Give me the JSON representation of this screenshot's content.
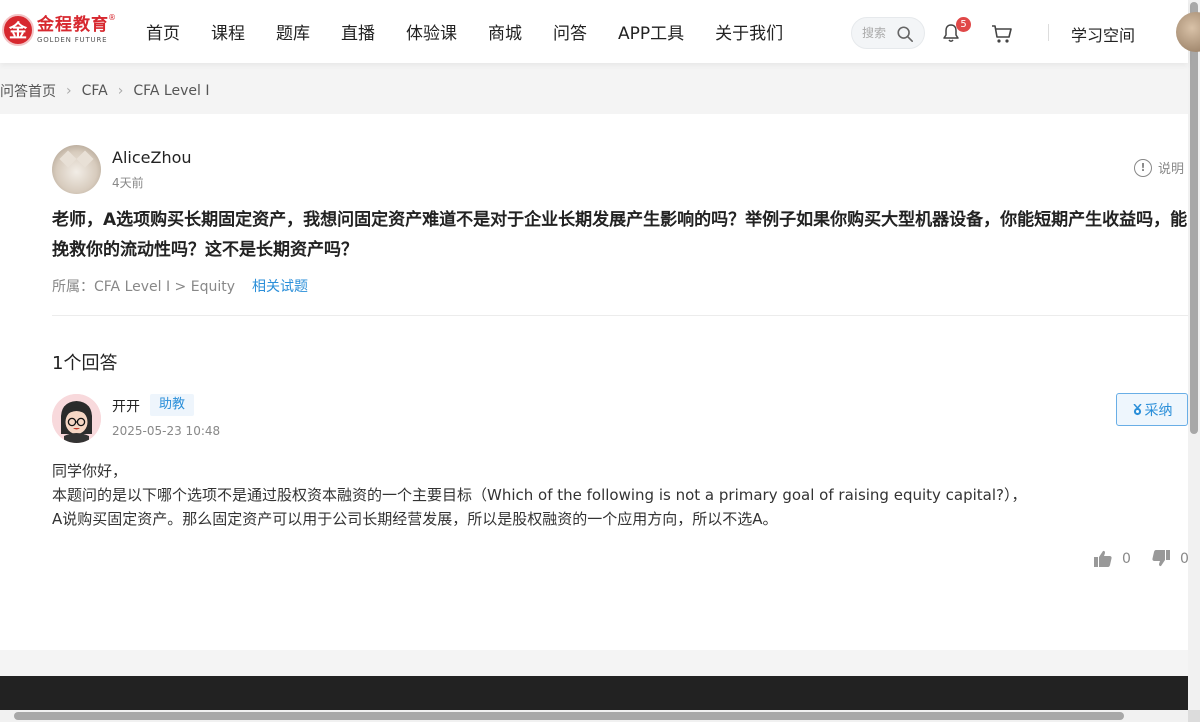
{
  "header": {
    "logo_mark": "金",
    "logo_cn": "金程教育",
    "logo_en": "GOLDEN FUTURE",
    "logo_reg": "®",
    "nav": [
      "首页",
      "课程",
      "题库",
      "直播",
      "体验课",
      "商城",
      "问答",
      "APP工具",
      "关于我们"
    ],
    "search_placeholder": "搜索",
    "notification_count": "5",
    "study_space": "学习空间"
  },
  "breadcrumb": [
    "问答首页",
    "CFA",
    "CFA Level I"
  ],
  "question": {
    "user": "AliceZhou",
    "time": "4天前",
    "explain_label": "说明",
    "text": "老师，A选项购买长期固定资产，我想问固定资产难道不是对于企业长期发展产生影响的吗？举例子如果你购买大型机器设备，你能短期产生收益吗，能挽救你的流动性吗？这不是长期资产吗？",
    "belong": "所属：CFA Level I > Equity",
    "related_label": "相关试题"
  },
  "answers": {
    "count_label": "1个回答",
    "items": [
      {
        "user": "开开",
        "role": "助教",
        "time": "2025-05-23 10:48",
        "accept_label": "采纳",
        "line1": "同学你好，",
        "line2": "本题问的是以下哪个选项不是通过股权资本融资的一个主要目标（Which of the following is not a primary goal of raising equity capital?），A说购买固定资产。那么固定资产可以用于公司长期经营发展，所以是股权融资的一个应用方向，所以不选A。",
        "likes": "0",
        "dislikes": "0"
      }
    ]
  },
  "colors": {
    "brand_red": "#d7282f",
    "link_blue": "#2b8fd9",
    "footer_dark": "#222222"
  }
}
